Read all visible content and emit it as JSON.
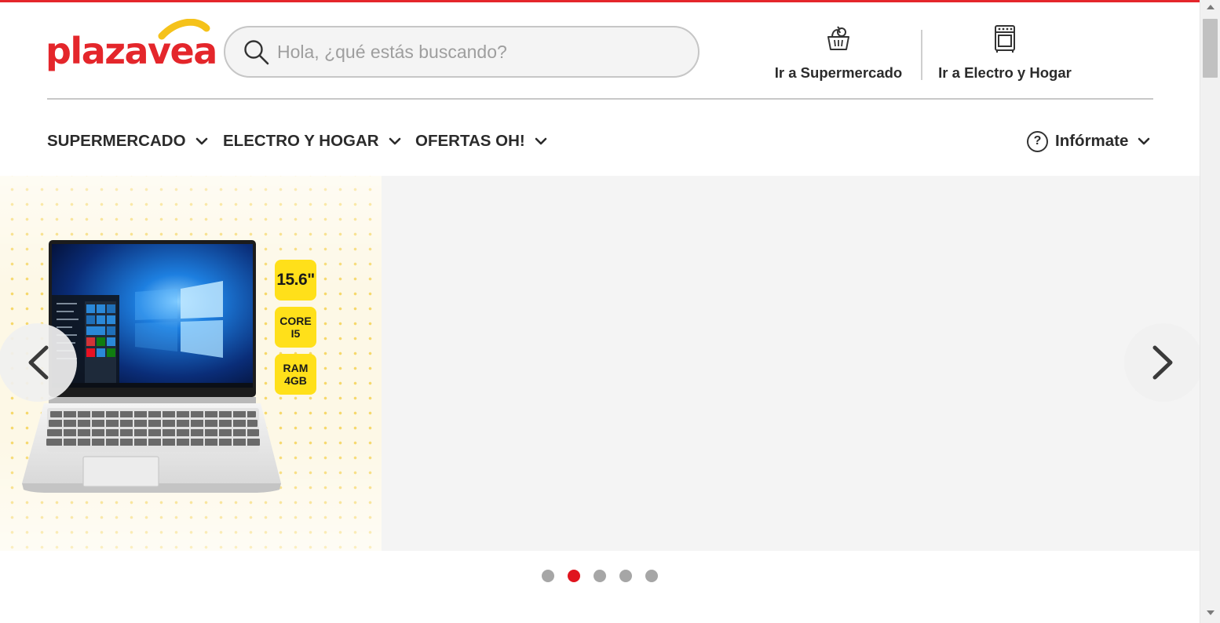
{
  "brand": {
    "name": "plazavea",
    "color": "#e4262b",
    "accent": "#f5c21a"
  },
  "search": {
    "placeholder": "Hola, ¿qué estás buscando?",
    "value": ""
  },
  "shortcuts": [
    {
      "label": "Ir a Supermercado",
      "icon": "grocery-basket-icon"
    },
    {
      "label": "Ir a Electro y Hogar",
      "icon": "stove-icon"
    }
  ],
  "nav": {
    "items": [
      {
        "label": "SUPERMERCADO"
      },
      {
        "label": "ELECTRO Y HOGAR"
      },
      {
        "label": "OFERTAS OH!"
      }
    ],
    "info": {
      "label": "Infórmate",
      "icon": "question-icon"
    }
  },
  "banner": {
    "specs": [
      "15.6\"",
      "CORE I5",
      "RAM 4GB"
    ],
    "spec_lines": [
      [
        "15.6\""
      ],
      [
        "CORE",
        "I5"
      ],
      [
        "RAM",
        "4GB"
      ]
    ],
    "prev_icon": "chevron-left-icon",
    "next_icon": "chevron-right-icon"
  },
  "carousel": {
    "slide_count": 5,
    "active_index": 1,
    "active_color": "#e0141e"
  }
}
